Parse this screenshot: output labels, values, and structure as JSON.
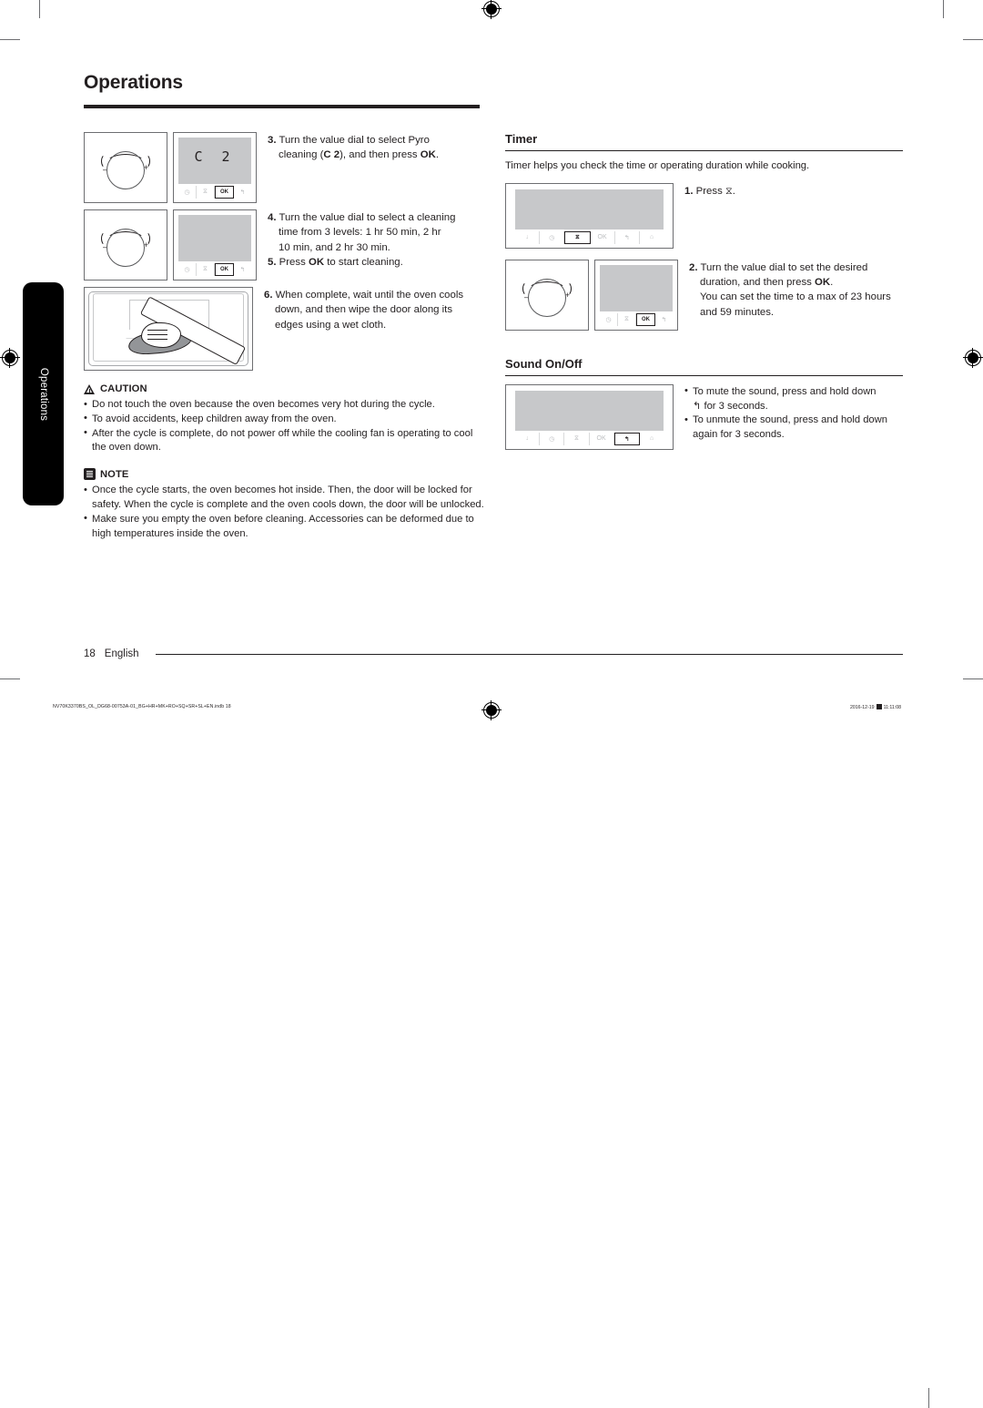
{
  "chapter": {
    "title": "Operations",
    "side_tab": "Operations"
  },
  "left_column": {
    "steps": [
      {
        "number": "3.",
        "lines": [
          "Turn the value dial to select Pyro",
          "cleaning (C 2), and then press OK."
        ],
        "figures": [
          "dial",
          "panel-c2"
        ]
      },
      {
        "number": "4.",
        "lines": [
          "Turn the value dial to select a cleaning",
          "time from 3 levels: 1 hr 50 min, 2 hr",
          "10 min, and 2 hr 30 min."
        ],
        "figures": [
          "dial",
          "panel-ok"
        ]
      },
      {
        "number": "5.",
        "lines": [
          "Press OK to start cleaning."
        ],
        "figures": []
      },
      {
        "number": "6.",
        "lines": [
          "When complete, wait until the oven cools",
          "down, and then wipe the door along its",
          "edges using a wet cloth."
        ],
        "figures": [
          "oven-wipe"
        ]
      }
    ],
    "caution": {
      "label": "CAUTION",
      "icon": "warning-triangle-icon",
      "items": [
        "Do not touch the oven because the oven becomes very hot during the cycle.",
        "To avoid accidents, keep children away from the oven.",
        "After the cycle is complete, do not power off while the cooling fan is operating to cool the oven down."
      ]
    },
    "note": {
      "label": "NOTE",
      "icon": "note-document-icon",
      "items": [
        "Once the cycle starts, the oven becomes hot inside. Then, the door will be locked for safety. When the cycle is complete and the oven cools down, the door will be unlocked.",
        "Make sure you empty the oven before cleaning. Accessories can be deformed due to high temperatures inside the oven."
      ]
    }
  },
  "right_column": {
    "timer": {
      "title": "Timer",
      "intro": "Timer helps you check the time or operating duration while cooking.",
      "steps": [
        {
          "number": "1.",
          "lines": [
            "Press ⧖."
          ],
          "figures": [
            "panel-timer"
          ]
        },
        {
          "number": "2.",
          "lines": [
            "Turn the value dial to set the desired",
            "duration, and then press OK.",
            "You can set the time to a max of 23 hours",
            "and 59 minutes."
          ],
          "figures": [
            "dial",
            "panel-ok"
          ]
        }
      ]
    },
    "sound": {
      "title": "Sound On/Off",
      "items": [
        "To mute the sound, press and hold down ↰ for 3 seconds.",
        "To unmute the sound, press and hold down again for 3 seconds."
      ],
      "figures": [
        "panel-back"
      ]
    }
  },
  "panel": {
    "display_value": "C 2",
    "keys": [
      "↓",
      "◷",
      "⧖",
      "OK",
      "↰",
      "⌂"
    ],
    "key_names": [
      "down-key",
      "clock-key",
      "timer-key",
      "ok-key",
      "back-key",
      "lock-key"
    ],
    "ok_label": "OK"
  },
  "footer": {
    "page_number": "18",
    "language": "English"
  },
  "print_footer": {
    "file": "NV70K3370BS_OL_DG68-00753A-01_BG+HR+MK+RO+SQ+SR+SL+EN.indb   18",
    "date": "2016-12-19",
    "time": "11:11:08"
  },
  "colors": {
    "ink": "#231f20",
    "screen_gray": "#c7c8ca",
    "rule": "#231f20"
  }
}
